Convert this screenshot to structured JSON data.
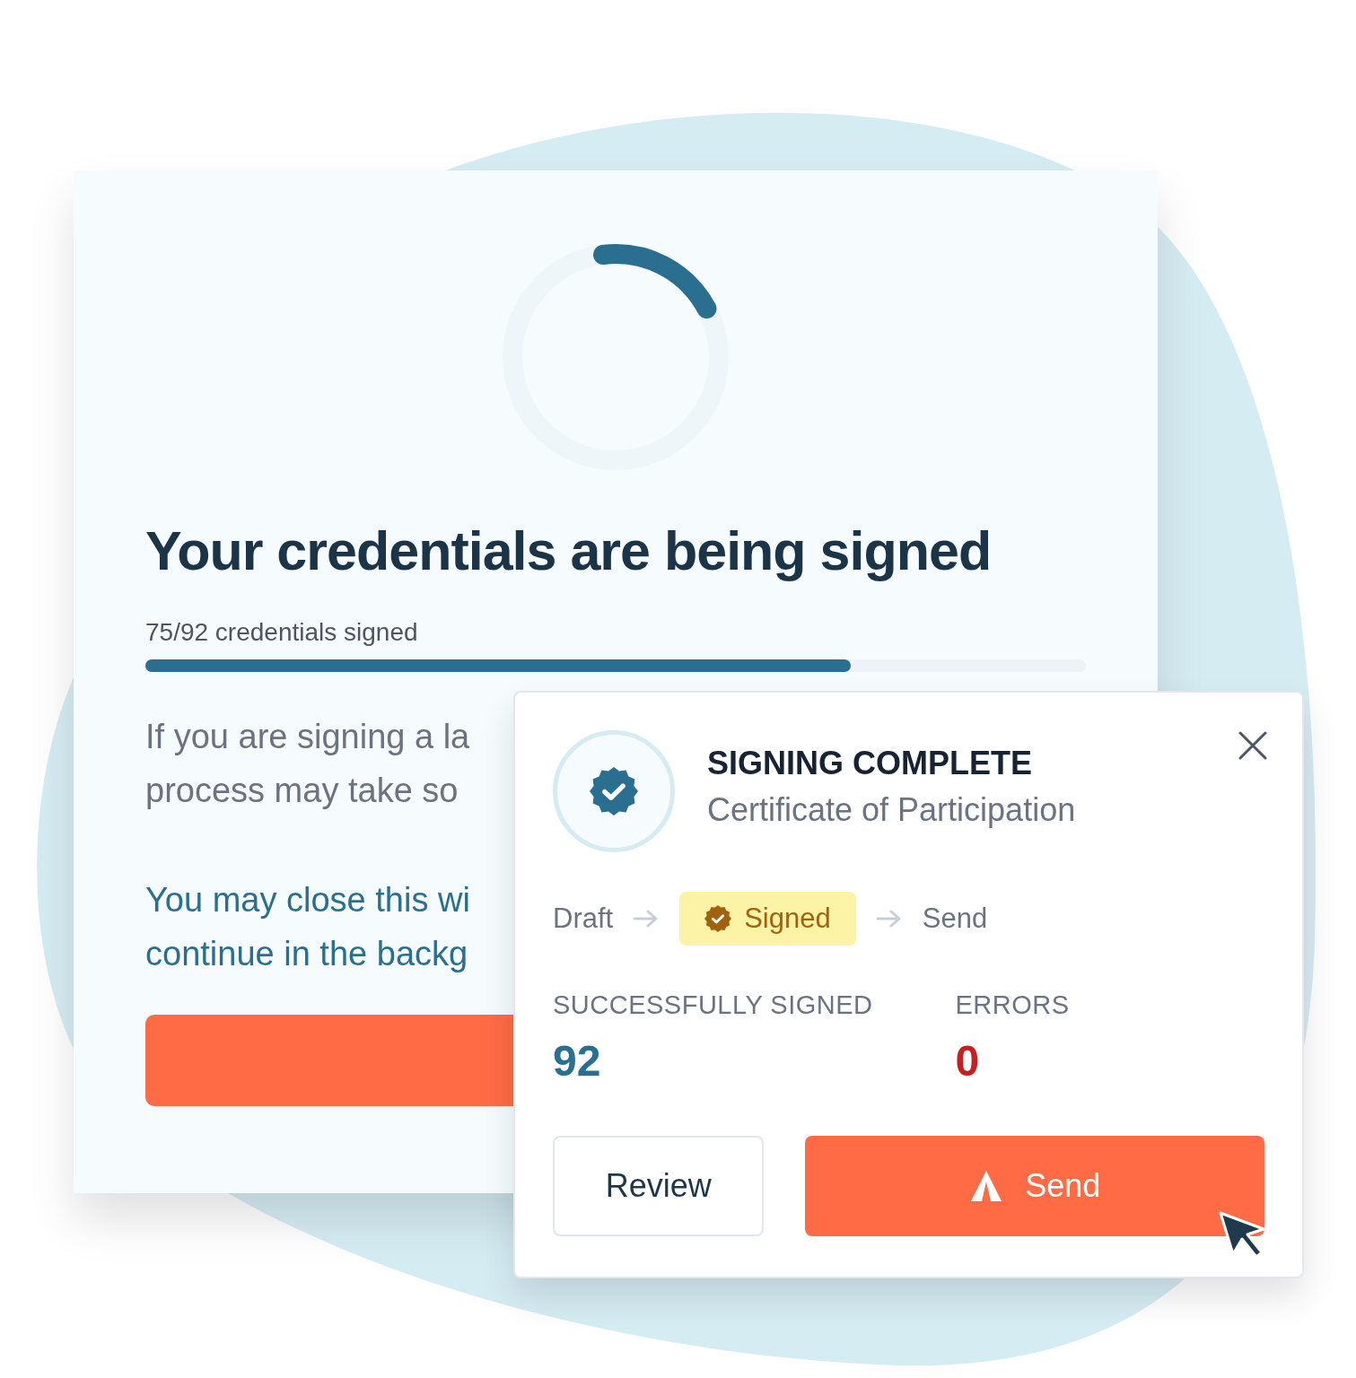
{
  "signing_card": {
    "title": "Your credentials are being signed",
    "progress": {
      "label": "75/92 credentials signed",
      "level": 0.75
    },
    "notice_lines": [
      "If you are signing a la",
      "process may take so"
    ],
    "background_lines": [
      "You may close this wi",
      "continue in the backg"
    ]
  },
  "toast": {
    "title": "SIGNING COMPLETE",
    "subtitle": "Certificate of Participation",
    "steps": [
      {
        "label": "Draft",
        "selected": false
      },
      {
        "label": "Signed",
        "selected": true
      },
      {
        "label": "Send",
        "selected": false
      }
    ],
    "stats": [
      {
        "label": "SUCCESSFULLY SIGNED",
        "value": "92",
        "kind": "success"
      },
      {
        "label": "ERRORS",
        "value": "0",
        "kind": "error"
      }
    ],
    "buttons": [
      {
        "label": "Review",
        "kind": "secondary"
      },
      {
        "label": "Send",
        "kind": "primary"
      }
    ]
  }
}
